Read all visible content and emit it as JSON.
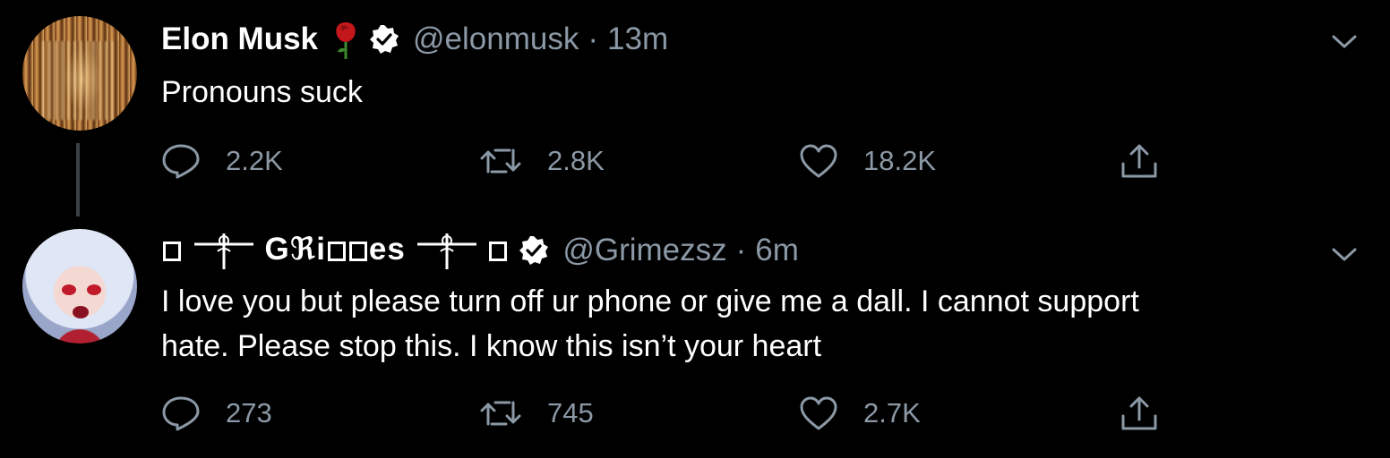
{
  "tweets": [
    {
      "author_name": "Elon Musk",
      "handle": "@elonmusk",
      "separator": "·",
      "time": "13m",
      "text": "Pronouns suck",
      "stats": {
        "replies": "2.2K",
        "retweets": "2.8K",
        "likes": "18.2K"
      }
    },
    {
      "author_name_parts": [
        "G",
        "ℜi",
        "es"
      ],
      "handle": "@Grimezsz",
      "separator": "·",
      "time": "6m",
      "text_line1": "I love you but please turn off ur phone or give me a dall.  I cannot support",
      "text_line2": "hate.  Please stop this. I know this isn’t your heart",
      "stats": {
        "replies": "273",
        "retweets": "745",
        "likes": "2.7K"
      }
    }
  ],
  "colors": {
    "background": "#000000",
    "text": "#ffffff",
    "muted": "#8b98a5",
    "rose": "#c4171c",
    "thread_line": "#3d4148"
  },
  "icons": [
    "rose-emoji-icon",
    "verified-badge-icon",
    "chevron-down-icon",
    "reply-icon",
    "retweet-icon",
    "like-icon",
    "share-icon",
    "dagger-rose-symbol-icon"
  ]
}
